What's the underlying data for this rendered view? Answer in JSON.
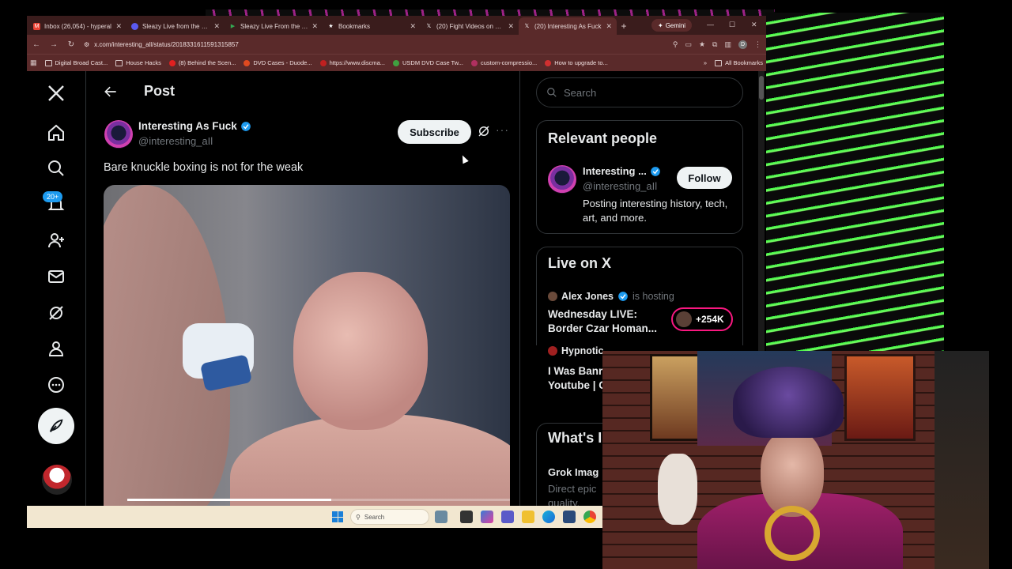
{
  "browser": {
    "tabs": [
      {
        "label": "Inbox (26,054) - hyperal",
        "favicon": "gmail-icon",
        "color": "#ea4335",
        "active": false
      },
      {
        "label": "Sleazy Live from the Bun",
        "favicon": "circle-icon",
        "color": "#5a5af0",
        "active": false
      },
      {
        "label": "Sleazy Live From the Bun",
        "favicon": "play-icon",
        "color": "#34a853",
        "active": false
      },
      {
        "label": "Bookmarks",
        "favicon": "star-icon",
        "color": "#e0d0d0",
        "active": false
      },
      {
        "label": "(20) Fight Videos on X: \"",
        "favicon": "x-icon",
        "color": "#ffffff",
        "active": false
      },
      {
        "label": "(20) Interesting As Fuck",
        "favicon": "x-icon",
        "color": "#ffffff",
        "active": true
      }
    ],
    "new_tab": "+",
    "gemini_label": "Gemini",
    "url": "x.com/interesting_all/status/2018331611591315857",
    "bookmarks": [
      {
        "label": "Digital Broad Cast..."
      },
      {
        "label": "House Hacks"
      },
      {
        "label": "(8) Behind the Scen..."
      },
      {
        "label": "DVD Cases - Duode..."
      },
      {
        "label": "https://www.discma..."
      },
      {
        "label": "USDM DVD Case Tw..."
      },
      {
        "label": "custom-compressio..."
      },
      {
        "label": "How to upgrade to..."
      }
    ],
    "all_bookmarks": "All Bookmarks",
    "more_bookmarks": "»",
    "profile_initial": "D"
  },
  "nav": {
    "notifications_badge": "20+"
  },
  "post": {
    "header_title": "Post",
    "author_name": "Interesting As Fuck",
    "author_handle": "@interesting_aIl",
    "subscribe_label": "Subscribe",
    "more": "···",
    "text": "Bare knuckle boxing is not for the weak",
    "video_progress_fraction": 0.52
  },
  "sidebar": {
    "search_placeholder": "Search",
    "relevant": {
      "title": "Relevant people",
      "name": "Interesting ...",
      "handle": "@interesting_aIl",
      "follow_label": "Follow",
      "bio": "Posting interesting history, tech, art, and more."
    },
    "live": {
      "title": "Live on X",
      "spaces": [
        {
          "host": "Alex Jones",
          "status": "is hosting",
          "topic": "Wednesday LIVE: Border Czar Homan...",
          "listeners": "+254K"
        },
        {
          "host": "Hypnotic",
          "status": "",
          "topic": "I Was Banr Youtube | C",
          "listeners": ""
        }
      ]
    },
    "whats_happening": {
      "title": "What's I",
      "item_title": "Grok Imag",
      "item_sub": "Direct epic quality."
    }
  },
  "taskbar": {
    "search_label": "Search"
  },
  "colors": {
    "x_blue": "#1d9bf0",
    "live_pink": "#f91880",
    "neon_green": "#35f03c"
  }
}
